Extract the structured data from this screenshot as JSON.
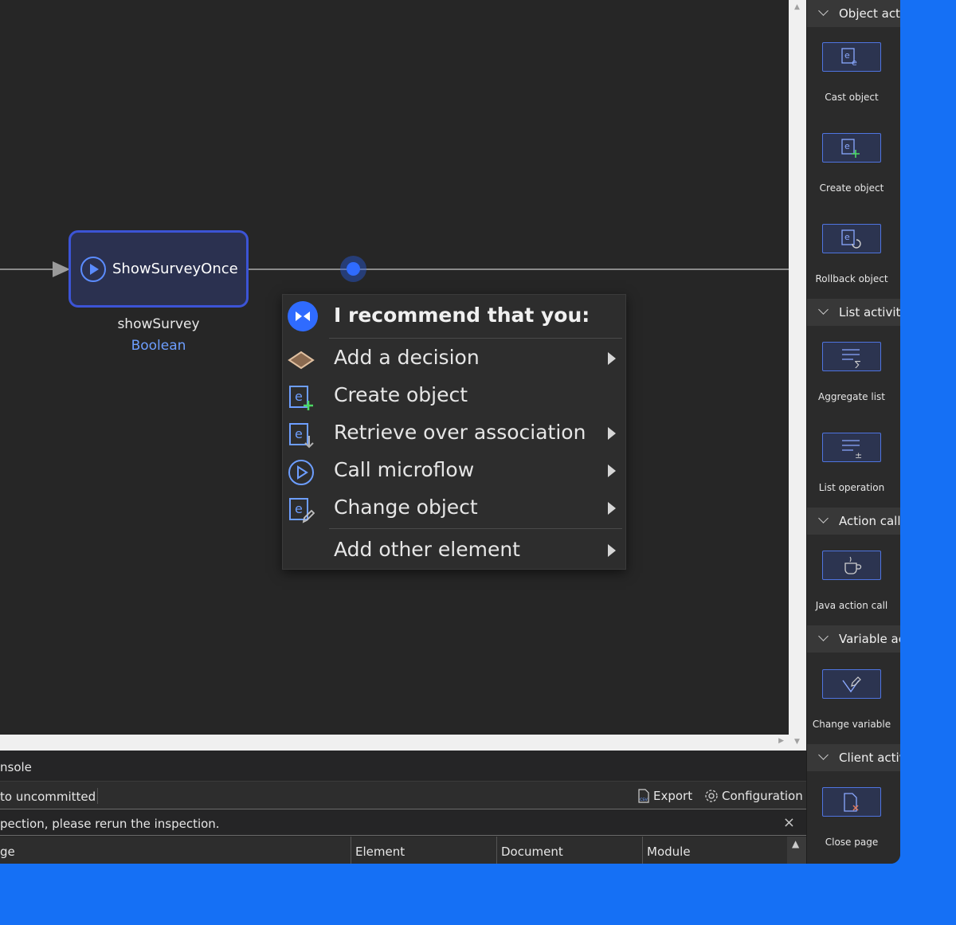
{
  "canvas": {
    "activity_label": "ShowSurveyOnce",
    "return_name": "showSurvey",
    "return_type": "Boolean"
  },
  "menu": {
    "title": "I recommend that you:",
    "items": [
      {
        "label": "Add a decision",
        "icon": "decision-diamond-icon",
        "submenu": true
      },
      {
        "label": "Create object",
        "icon": "create-object-icon",
        "submenu": false
      },
      {
        "label": "Retrieve over association",
        "icon": "retrieve-icon",
        "submenu": true
      },
      {
        "label": "Call microflow",
        "icon": "microflow-play-icon",
        "submenu": true
      },
      {
        "label": "Change object",
        "icon": "change-object-icon",
        "submenu": true
      },
      {
        "label": "Add other element",
        "icon": "",
        "submenu": true
      }
    ]
  },
  "console": {
    "tab_label": "nsole",
    "filter_label": "to uncommitted",
    "export_label": "Export",
    "config_label": "Configuration",
    "message": "pection, please rerun the inspection.",
    "close_glyph": "×",
    "columns": [
      "ge",
      "Element",
      "Document",
      "Module"
    ]
  },
  "toolbox": {
    "categories": [
      {
        "label": "Object activ",
        "items": [
          "Cast object",
          "Create object",
          "Rollback object"
        ]
      },
      {
        "label": "List activitie",
        "items": [
          "Aggregate list",
          "List operation"
        ]
      },
      {
        "label": "Action call a",
        "items": [
          "Java action call"
        ]
      },
      {
        "label": "Variable act",
        "items": [
          "Change variable"
        ]
      },
      {
        "label": "Client activi",
        "items": [
          "Close page"
        ]
      }
    ]
  },
  "colors": {
    "accent": "#2f6bff",
    "background": "#1570f5",
    "panel": "#252526"
  }
}
